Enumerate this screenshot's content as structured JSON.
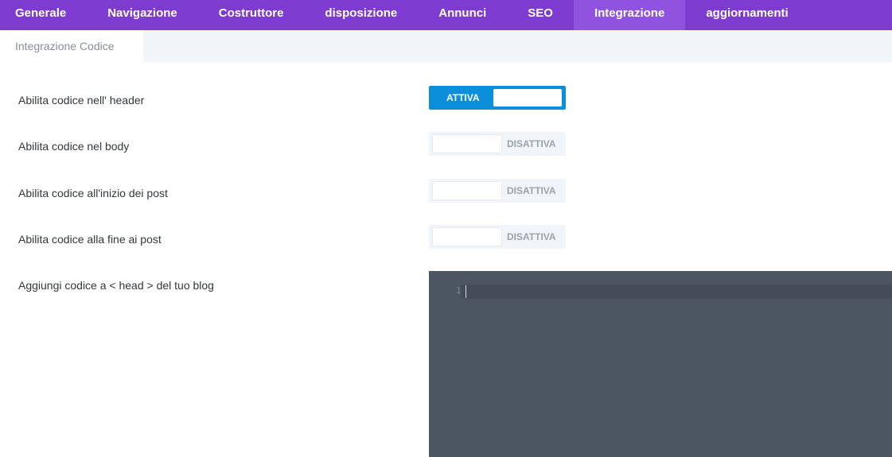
{
  "tabs": [
    {
      "label": "Generale"
    },
    {
      "label": "Navigazione"
    },
    {
      "label": "Costruttore"
    },
    {
      "label": "disposizione"
    },
    {
      "label": "Annunci"
    },
    {
      "label": "SEO"
    },
    {
      "label": "Integrazione"
    },
    {
      "label": "aggiornamenti"
    }
  ],
  "subtab": {
    "label": "Integrazione Codice"
  },
  "settings": [
    {
      "label": "Abilita codice nell' header",
      "state": "ATTIVA"
    },
    {
      "label": "Abilita codice nel body",
      "state": "DISATTIVA"
    },
    {
      "label": "Abilita codice all'inizio dei post",
      "state": "DISATTIVA"
    },
    {
      "label": "Abilita codice alla fine ai post",
      "state": "DISATTIVA"
    }
  ],
  "head_code": {
    "label": "Aggiungi codice a < head > del tuo blog",
    "line_number": "1",
    "content": ""
  },
  "colors": {
    "accent_purple": "#7e3bd0",
    "active_tab": "#8f53e0",
    "toggle_on": "#0c8fdb",
    "editor_bg": "#4c5663"
  }
}
